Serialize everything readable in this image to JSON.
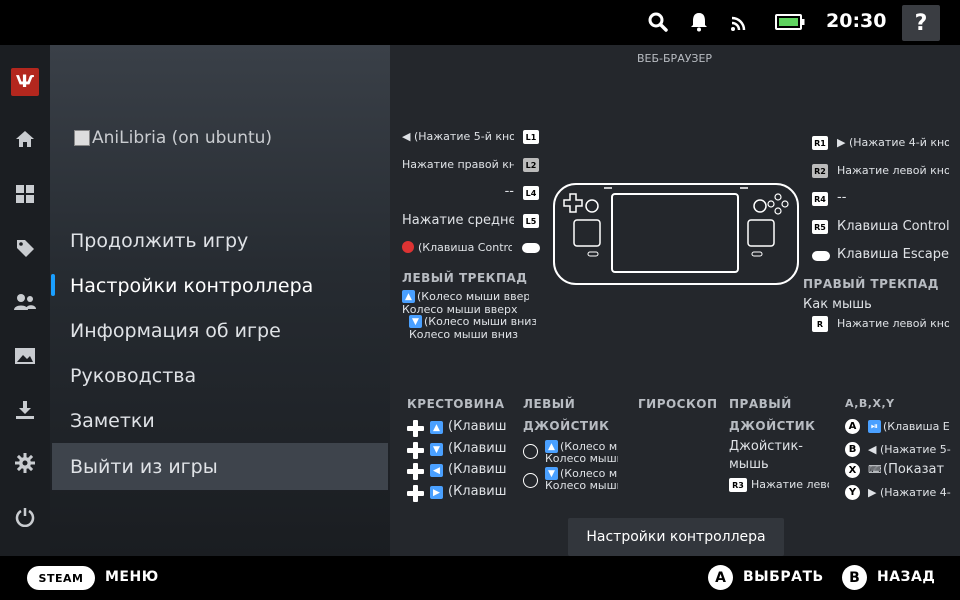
{
  "topbar": {
    "clock": "20:30",
    "help_label": "?",
    "icons": [
      "search-icon",
      "bell-icon",
      "cast-icon",
      "battery-icon"
    ]
  },
  "rail": {
    "logo_text": "Ѱ",
    "items": [
      "home-icon",
      "library-icon",
      "tag-icon",
      "friends-icon",
      "media-icon",
      "downloads-icon",
      "settings-icon",
      "power-icon"
    ]
  },
  "game": {
    "title": "AniLibria (on ubuntu)"
  },
  "menu": {
    "items": [
      {
        "label": "Продолжить игру"
      },
      {
        "label": "Настройки контроллера"
      },
      {
        "label": "Информация об игре"
      },
      {
        "label": "Руководства"
      },
      {
        "label": "Заметки"
      },
      {
        "label": "Выйти из игры"
      }
    ]
  },
  "controller": {
    "header": "ВЕБ-БРАУЗЕР",
    "left": {
      "l1": {
        "badge": "L1",
        "text": "◀ (Нажатие 5-й кноп"
      },
      "l2": {
        "badge": "L2",
        "text": "Нажатие правой кноп"
      },
      "l4": {
        "badge": "L4",
        "text": "--"
      },
      "l5": {
        "badge": "L5",
        "text": "Нажатие средней"
      },
      "view": {
        "text": "(Клавиша Control)"
      }
    },
    "right": {
      "r1": {
        "badge": "R1",
        "text": "▶ (Нажатие 4-й кноп"
      },
      "r2": {
        "badge": "R2",
        "text": "Нажатие левой кноп"
      },
      "r4": {
        "badge": "R4",
        "text": "--"
      },
      "r5": {
        "badge": "R5",
        "text": "Клавиша Control"
      },
      "menu": {
        "text": "Клавиша Escape"
      }
    },
    "left_trackpad": {
      "title": "ЛЕВЫЙ ТРЕКПАД",
      "line1": "(Колесо мыши вверх)",
      "line2": "Колесо мыши вверх",
      "line3": "(Колесо мыши вниз)",
      "line4": "Колесо мыши вниз"
    },
    "right_trackpad": {
      "title": "ПРАВЫЙ ТРЕКПАД",
      "mode": "Как мышь",
      "click_badge": "R",
      "click": "Нажатие левой кноп"
    },
    "dpad": {
      "title": "КРЕСТОВИНА",
      "rows": [
        "(Клавиш",
        "(Клавиш",
        "(Клавиш",
        "(Клавиш"
      ]
    },
    "left_stick": {
      "title1": "ЛЕВЫЙ",
      "title2": "ДЖОЙСТИК",
      "r1a": "(Колесо мы",
      "r1b": "Колесо мыши",
      "r2a": "(Колесо мы",
      "r2b": "Колесо мыши"
    },
    "gyro": {
      "title": "ГИРОСКОП"
    },
    "right_stick": {
      "title1": "ПРАВЫЙ",
      "title2": "ДЖОЙСТИК",
      "mode1": "Джойстик-",
      "mode2": "мышь",
      "click_badge": "R3",
      "click": "Нажатие лево"
    },
    "abxy": {
      "title": "A,B,X,Y",
      "a": {
        "badge": "A",
        "text": "(Клавиша Е"
      },
      "b": {
        "badge": "B",
        "text": "◀ (Нажатие 5-"
      },
      "x": {
        "badge": "X",
        "text": "(Показат"
      },
      "y": {
        "badge": "Y",
        "text": "▶ (Нажатие 4-"
      }
    },
    "footer_button": "Настройки контроллера"
  },
  "bottombar": {
    "steam": "STEAM",
    "menu": "МЕНЮ",
    "a_badge": "A",
    "select": "ВЫБРАТЬ",
    "b_badge": "B",
    "back": "НАЗАД"
  },
  "colors": {
    "accent": "#1a9fff",
    "logo": "#b3271e",
    "battery": "#5fd35f"
  }
}
